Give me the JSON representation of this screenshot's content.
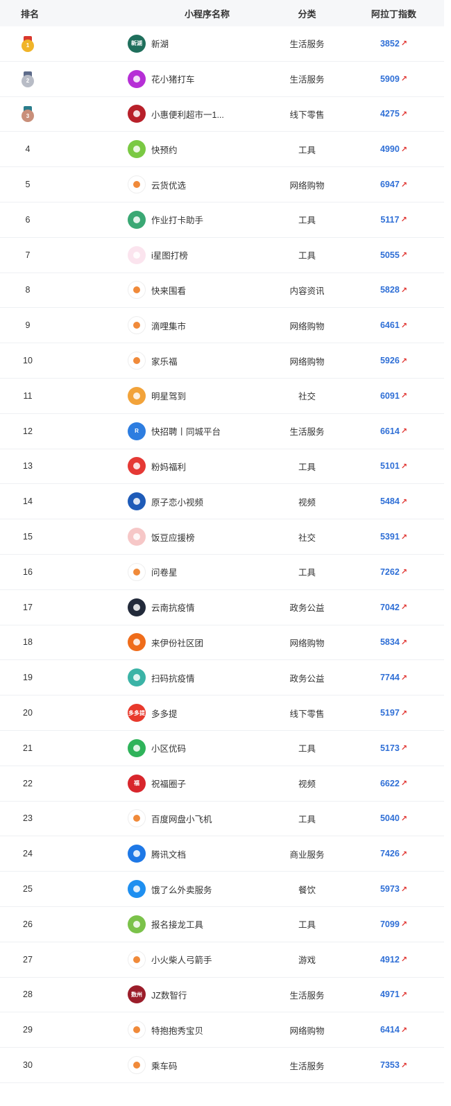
{
  "header": {
    "rank": "排名",
    "name": "小程序名称",
    "category": "分类",
    "index": "阿拉丁指数"
  },
  "colors": {
    "index_blue": "#2f6fd6",
    "trend_red": "#e0332f",
    "gold": "#f0b429",
    "silver": "#b8bcc6",
    "bronze": "#c98f7a"
  },
  "rows": [
    {
      "rank": "1",
      "medal": "gold",
      "name": "新湖",
      "category": "生活服务",
      "index": "3852",
      "icon": "xinhu-logo-icon",
      "logo_color": "#1f6f5c",
      "logo_text": "新湖"
    },
    {
      "rank": "2",
      "medal": "silver",
      "name": "花小猪打车",
      "category": "生活服务",
      "index": "5909",
      "icon": "pig-logo-icon",
      "logo_color": "#b62fd6",
      "logo_text": ""
    },
    {
      "rank": "3",
      "medal": "bronze",
      "name": "小惠便利超市一1...",
      "category": "线下零售",
      "index": "4275",
      "icon": "store-logo-icon",
      "logo_color": "#b8202a",
      "logo_text": ""
    },
    {
      "rank": "4",
      "name": "快预约",
      "category": "工具",
      "index": "4990",
      "icon": "calendar-logo-icon",
      "logo_color": "#7ac943",
      "logo_text": ""
    },
    {
      "rank": "5",
      "name": "云货优选",
      "category": "网络购物",
      "index": "6947",
      "icon": "bag-logo-icon",
      "logo_color": "#ffffff",
      "logo_text": ""
    },
    {
      "rank": "6",
      "name": "作业打卡助手",
      "category": "工具",
      "index": "5117",
      "icon": "bottle-logo-icon",
      "logo_color": "#3aa874",
      "logo_text": ""
    },
    {
      "rank": "7",
      "name": "i星图打榜",
      "category": "工具",
      "index": "5055",
      "icon": "star-triangle-logo-icon",
      "logo_color": "#fbe4ee",
      "logo_text": ""
    },
    {
      "rank": "8",
      "name": "快来围看",
      "category": "内容资讯",
      "index": "5828",
      "icon": "mascot-logo-icon",
      "logo_color": "#ffffff",
      "logo_text": ""
    },
    {
      "rank": "9",
      "name": "滴哩集市",
      "category": "网络购物",
      "index": "6461",
      "icon": "cart-logo-icon",
      "logo_color": "#ffffff",
      "logo_text": ""
    },
    {
      "rank": "10",
      "name": "家乐福",
      "category": "网络购物",
      "index": "5926",
      "icon": "carrefour-logo-icon",
      "logo_color": "#ffffff",
      "logo_text": ""
    },
    {
      "rank": "11",
      "name": "明星驾到",
      "category": "社交",
      "index": "6091",
      "icon": "star-logo-icon",
      "logo_color": "#f2a33a",
      "logo_text": ""
    },
    {
      "rank": "12",
      "name": "快招聘丨同城平台",
      "category": "生活服务",
      "index": "6614",
      "icon": "recruit-logo-icon",
      "logo_color": "#2d7de0",
      "logo_text": "R"
    },
    {
      "rank": "13",
      "name": "粉妈福利",
      "category": "工具",
      "index": "5101",
      "icon": "fenma-logo-icon",
      "logo_color": "#e53935",
      "logo_text": ""
    },
    {
      "rank": "14",
      "name": "原子恋小视频",
      "category": "视频",
      "index": "5484",
      "icon": "atom-logo-icon",
      "logo_color": "#1e5bb8",
      "logo_text": ""
    },
    {
      "rank": "15",
      "name": "饭豆应援榜",
      "category": "社交",
      "index": "5391",
      "icon": "bean-logo-icon",
      "logo_color": "#f6c7c7",
      "logo_text": ""
    },
    {
      "rank": "16",
      "name": "问卷星",
      "category": "工具",
      "index": "7262",
      "icon": "outline-star-logo-icon",
      "logo_color": "#ffffff",
      "logo_text": ""
    },
    {
      "rank": "17",
      "name": "云南抗疫情",
      "category": "政务公益",
      "index": "7042",
      "icon": "yunnan-logo-icon",
      "logo_color": "#222a3a",
      "logo_text": ""
    },
    {
      "rank": "18",
      "name": "来伊份社区团",
      "category": "网络购物",
      "index": "5834",
      "icon": "laiyifen-logo-icon",
      "logo_color": "#ef6c1a",
      "logo_text": ""
    },
    {
      "rank": "19",
      "name": "扫码抗疫情",
      "category": "政务公益",
      "index": "7744",
      "icon": "scan-logo-icon",
      "logo_color": "#3bb3a6",
      "logo_text": ""
    },
    {
      "rank": "20",
      "name": "多多提",
      "category": "线下零售",
      "index": "5197",
      "icon": "duoduoti-logo-icon",
      "logo_color": "#e8392c",
      "logo_text": "多多提"
    },
    {
      "rank": "21",
      "name": "小区优码",
      "category": "工具",
      "index": "5173",
      "icon": "house-logo-icon",
      "logo_color": "#2fb35a",
      "logo_text": ""
    },
    {
      "rank": "22",
      "name": "祝福圈子",
      "category": "视频",
      "index": "6622",
      "icon": "fu-logo-icon",
      "logo_color": "#d8262c",
      "logo_text": "福"
    },
    {
      "rank": "23",
      "name": "百度网盘小飞机",
      "category": "工具",
      "index": "5040",
      "icon": "paper-plane-logo-icon",
      "logo_color": "#ffffff",
      "logo_text": ""
    },
    {
      "rank": "24",
      "name": "腾讯文档",
      "category": "商业服务",
      "index": "7426",
      "icon": "tencent-docs-logo-icon",
      "logo_color": "#1e78e6",
      "logo_text": ""
    },
    {
      "rank": "25",
      "name": "饿了么外卖服务",
      "category": "餐饮",
      "index": "5973",
      "icon": "eleme-logo-icon",
      "logo_color": "#1e8ff0",
      "logo_text": ""
    },
    {
      "rank": "26",
      "name": "报名接龙工具",
      "category": "工具",
      "index": "7099",
      "icon": "checkmark-logo-icon",
      "logo_color": "#7bc24a",
      "logo_text": ""
    },
    {
      "rank": "27",
      "name": "小火柴人弓箭手",
      "category": "游戏",
      "index": "4912",
      "icon": "stickman-logo-icon",
      "logo_color": "#ffffff",
      "logo_text": ""
    },
    {
      "rank": "28",
      "name": "JZ数智行",
      "category": "生活服务",
      "index": "4971",
      "icon": "jz-logo-icon",
      "logo_color": "#9b1d2a",
      "logo_text": "数州"
    },
    {
      "rank": "29",
      "name": "特抱抱秀宝贝",
      "category": "网络购物",
      "index": "6414",
      "icon": "xiu-logo-icon",
      "logo_color": "#ffffff",
      "logo_text": ""
    },
    {
      "rank": "30",
      "name": "乘车码",
      "category": "生活服务",
      "index": "7353",
      "icon": "ride-code-logo-icon",
      "logo_color": "#ffffff",
      "logo_text": ""
    }
  ]
}
